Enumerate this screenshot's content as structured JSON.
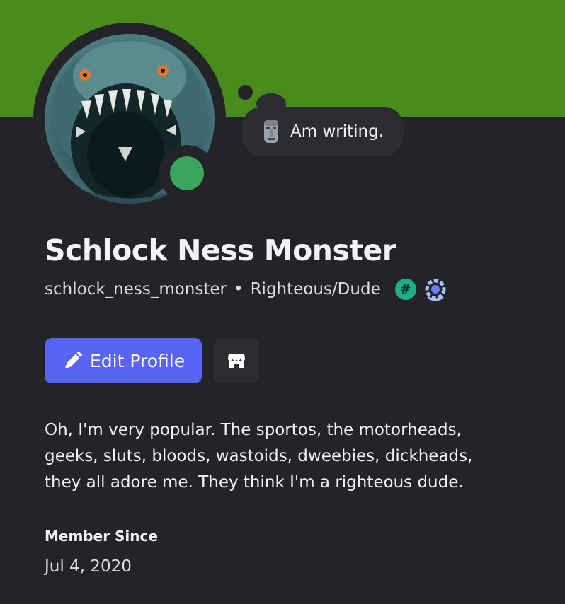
{
  "profile": {
    "banner_color": "#4a8b1e",
    "status_color": "#3ba55c",
    "custom_status": {
      "emoji": "moai-emoji-icon",
      "text": "Am writing."
    },
    "display_name": "Schlock Ness Monster",
    "username": "schlock_ness_monster",
    "separator": "•",
    "pronouns": "Righteous/Dude",
    "badges": [
      {
        "icon": "hashtag-badge-icon",
        "glyph": "#"
      },
      {
        "icon": "laurel-badge-icon"
      }
    ]
  },
  "actions": {
    "edit_label": "Edit Profile",
    "accent_color": "#5865f2",
    "shop_icon": "shop-icon"
  },
  "about": {
    "bio": "Oh, I'm very popular. The sportos, the motorheads, geeks, sluts, bloods, wastoids, dweebies, dickheads, they all adore me. They think I'm a righteous dude."
  },
  "member_since": {
    "heading": "Member Since",
    "date": "Jul 4, 2020"
  }
}
